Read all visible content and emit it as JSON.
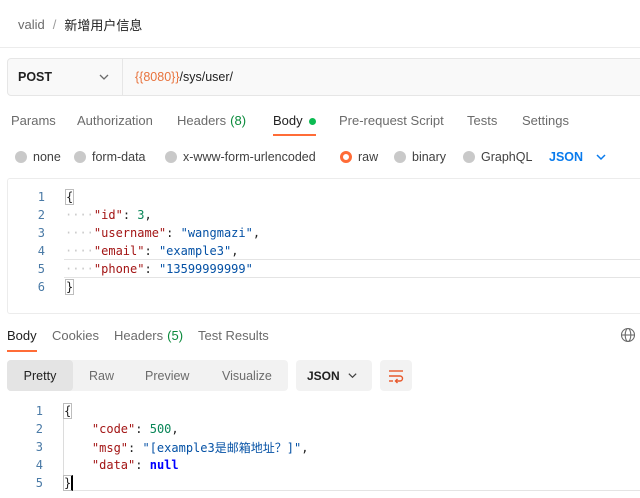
{
  "breadcrumb": {
    "parent": "valid",
    "separator": "/",
    "current": "新增用户信息"
  },
  "request": {
    "method": "POST",
    "url_variable": "{{8080}}",
    "url_path": "/sys/user/"
  },
  "request_tabs": [
    {
      "label": "Params"
    },
    {
      "label": "Authorization"
    },
    {
      "label": "Headers",
      "count": "(8)"
    },
    {
      "label": "Body",
      "active": true
    },
    {
      "label": "Pre-request Script"
    },
    {
      "label": "Tests"
    },
    {
      "label": "Settings"
    }
  ],
  "body_options": {
    "none": "none",
    "form_data": "form-data",
    "urlencoded": "x-www-form-urlencoded",
    "raw": "raw",
    "binary": "binary",
    "graphql": "GraphQL",
    "selected": "raw",
    "language": "JSON"
  },
  "request_body": {
    "line_numbers": [
      "1",
      "2",
      "3",
      "4",
      "5",
      "6"
    ],
    "open_brace": "{",
    "close_brace": "}",
    "fields": [
      {
        "key": "\"id\"",
        "value": "3",
        "sep": ",",
        "type": "number"
      },
      {
        "key": "\"username\"",
        "value": "\"wangmazi\"",
        "sep": ",",
        "type": "string"
      },
      {
        "key": "\"email\"",
        "value": "\"example3\"",
        "sep": ",",
        "type": "string"
      },
      {
        "key": "\"phone\"",
        "value": "\"13599999999\"",
        "sep": "",
        "type": "string"
      }
    ],
    "indent_marker": "····"
  },
  "response_tabs": {
    "body": "Body",
    "cookies": "Cookies",
    "headers": "Headers",
    "headers_count": "(5)",
    "test_results": "Test Results"
  },
  "response_toolbar": {
    "pretty": "Pretty",
    "raw": "Raw",
    "preview": "Preview",
    "visualize": "Visualize",
    "format": "JSON"
  },
  "response_body": {
    "line_numbers": [
      "1",
      "2",
      "3",
      "4",
      "5"
    ],
    "open_brace": "{",
    "close_brace": "}",
    "code_key": "\"code\"",
    "code_value": "500",
    "msg_key": "\"msg\"",
    "msg_value": "\"[example3是邮箱地址？]\"",
    "data_key": "\"data\"",
    "data_value": "null"
  },
  "colors": {
    "accent": "#ff6c37",
    "link_blue": "#097bed",
    "count_green": "#0a8a3b",
    "dot_green": "#0cbb52",
    "url_variable": "#e8733d"
  },
  "icons": {
    "method_dropdown": "chevron-down-icon",
    "language_dropdown": "chevron-down-icon",
    "format_dropdown": "chevron-down-icon",
    "wrap": "wrap-lines-icon",
    "globe": "globe-icon"
  }
}
